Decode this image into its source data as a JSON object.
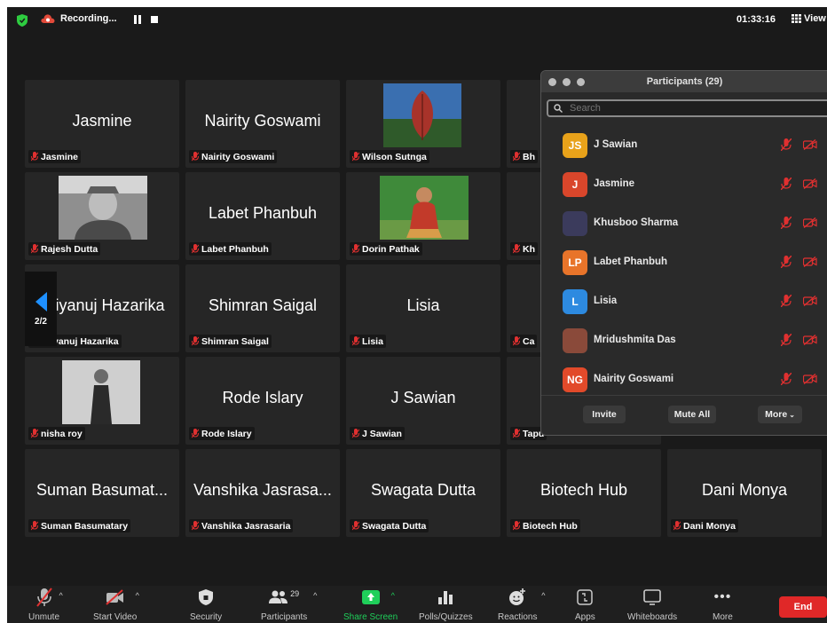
{
  "topbar": {
    "recording_label": "Recording...",
    "clock": "01:33:16",
    "view_label": "View"
  },
  "gallery": {
    "tiles": [
      {
        "big": "Jasmine",
        "tag": "Jasmine"
      },
      {
        "big": "Nairity Goswami",
        "tag": "Nairity Goswami"
      },
      {
        "big": "",
        "tag": "Wilson Sutnga"
      },
      {
        "big": "",
        "tag": "Bh"
      },
      {
        "big": "",
        "tag": "Rajesh Dutta"
      },
      {
        "big": "Labet Phanbuh",
        "tag": "Labet Phanbuh"
      },
      {
        "big": "",
        "tag": "Dorin Pathak"
      },
      {
        "big": "",
        "tag": "Kh"
      },
      {
        "big": "Priyanuj Hazarika",
        "tag": "Priyanuj Hazarika"
      },
      {
        "big": "Shimran Saigal",
        "tag": "Shimran Saigal"
      },
      {
        "big": "Lisia",
        "tag": "Lisia"
      },
      {
        "big": "",
        "tag": "Ca"
      },
      {
        "big": "",
        "tag": "nisha roy"
      },
      {
        "big": "Rode Islary",
        "tag": "Rode Islary"
      },
      {
        "big": "J Sawian",
        "tag": "J Sawian"
      },
      {
        "big": "",
        "tag": "Tapu"
      },
      {
        "big": "Suman Basumat...",
        "tag": "Suman Basumatary"
      },
      {
        "big": "Vanshika Jasrasa...",
        "tag": "Vanshika Jasrasaria"
      },
      {
        "big": "Swagata Dutta",
        "tag": "Swagata Dutta"
      },
      {
        "big": "Biotech Hub",
        "tag": "Biotech Hub"
      },
      {
        "big": "Dani Monya",
        "tag": "Dani Monya"
      }
    ],
    "page_indicator": "2/2"
  },
  "participants_panel": {
    "title": "Participants (29)",
    "search_placeholder": "Search",
    "participants": [
      {
        "initials": "JS",
        "name": "J Sawian",
        "color": "#e8a21a"
      },
      {
        "initials": "J",
        "name": "Jasmine",
        "color": "#d9462b"
      },
      {
        "initials": "",
        "name": "Khusboo Sharma",
        "color": "#3b3b5c"
      },
      {
        "initials": "LP",
        "name": "Labet Phanbuh",
        "color": "#e8742a"
      },
      {
        "initials": "L",
        "name": "Lisia",
        "color": "#2d8ae0"
      },
      {
        "initials": "",
        "name": "Mridushmita Das",
        "color": "#8a4a3a"
      },
      {
        "initials": "NG",
        "name": "Nairity Goswami",
        "color": "#e24a2a"
      }
    ],
    "invite_label": "Invite",
    "mute_all_label": "Mute All",
    "more_label": "More"
  },
  "toolbar": {
    "unmute": "Unmute",
    "start_video": "Start Video",
    "security": "Security",
    "participants": "Participants",
    "participants_count": "29",
    "share_screen": "Share Screen",
    "polls": "Polls/Quizzes",
    "reactions": "Reactions",
    "apps": "Apps",
    "whiteboards": "Whiteboards",
    "more": "More",
    "end": "End"
  },
  "colors": {
    "share_green": "#1fcf5a",
    "end_red": "#e02828",
    "muted_red": "#e03030"
  }
}
